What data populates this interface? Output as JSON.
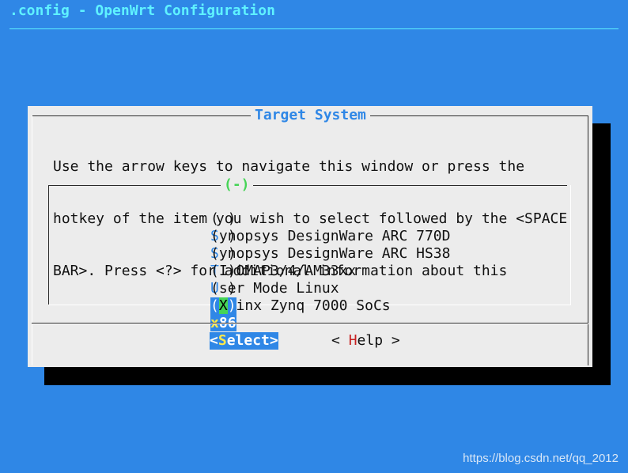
{
  "app": {
    "title": ".config - OpenWrt Configuration"
  },
  "dialog": {
    "title": "Target System",
    "help_lines": [
      "Use the arrow keys to navigate this window or press the",
      "hotkey of the item you wish to select followed by the <SPACE",
      "BAR>. Press <?> for additional information about this"
    ],
    "scroll_marker": "(-)",
    "items": [
      {
        "mark_open": "(",
        "mark_value": " ",
        "mark_close": ")",
        "hotkey": "S",
        "rest": "ynopsys DesignWare ARC 770D",
        "selected": false
      },
      {
        "mark_open": "(",
        "mark_value": " ",
        "mark_close": ")",
        "hotkey": "S",
        "rest": "ynopsys DesignWare ARC HS38",
        "selected": false
      },
      {
        "mark_open": "(",
        "mark_value": " ",
        "mark_close": ")",
        "hotkey": "T",
        "rest": "I OMAP3/4/AM33xx",
        "selected": false
      },
      {
        "mark_open": "(",
        "mark_value": " ",
        "mark_close": ")",
        "hotkey": "U",
        "rest": "ser Mode Linux",
        "selected": false
      },
      {
        "mark_open": "(",
        "mark_value": " ",
        "mark_close": ")",
        "hotkey": "X",
        "rest": "ilinx Zynq 7000 SoCs",
        "selected": false
      },
      {
        "mark_open": "(",
        "mark_value": "X",
        "mark_close": ")",
        "hotkey": "x",
        "rest": "86",
        "selected": true
      }
    ],
    "buttons": {
      "select": {
        "open": "<",
        "hotkey": "S",
        "rest": "elect",
        "close": ">"
      },
      "help": {
        "open": "< ",
        "hotkey": "H",
        "rest": "elp",
        "close": " >"
      }
    }
  },
  "watermark": "https://blog.csdn.net/qq_2012",
  "colors": {
    "background": "#2f87e6",
    "dialog": "#ececec",
    "title": "#5ff2ff",
    "accent_green": "#46d456",
    "hotkey_red": "#c62020",
    "hotkey_yellow": "#ffe94a"
  }
}
